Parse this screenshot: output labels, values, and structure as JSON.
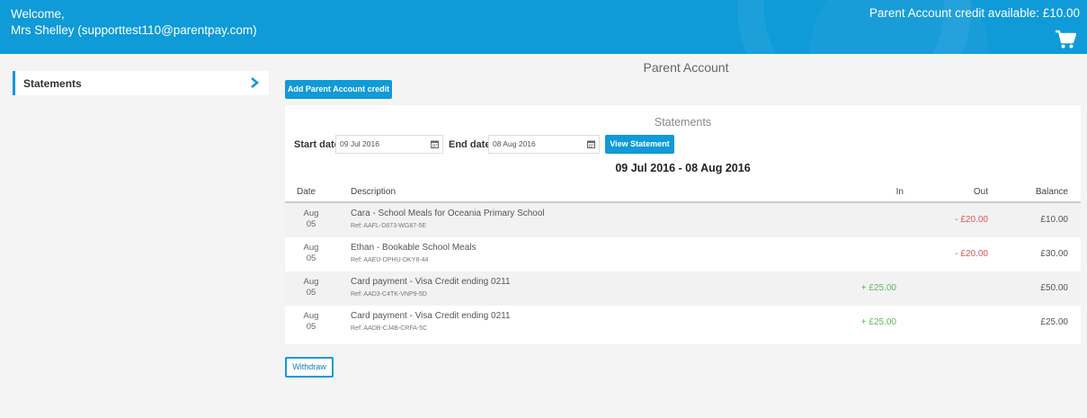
{
  "header": {
    "welcome": "Welcome,",
    "user": "Mrs Shelley (supporttest110@parentpay.com)",
    "credit_text": "Parent Account credit available: £10.00",
    "cart_icon": "shopping-cart-icon"
  },
  "sidebar": {
    "items": [
      {
        "label": "Statements",
        "icon": "chevron-right-icon"
      }
    ]
  },
  "main": {
    "title": "Parent Account",
    "add_credit_label": "Add Parent Account credit",
    "statements": {
      "title": "Statements",
      "start_label": "Start date",
      "start_value": "09 Jul 2016",
      "end_label": "End date",
      "end_value": "08 Aug 2016",
      "view_label": "View Statement",
      "range": "09 Jul 2016 - 08 Aug 2016",
      "columns": [
        "Date",
        "Description",
        "In",
        "Out",
        "Balance"
      ],
      "rows": [
        {
          "month": "Aug",
          "day": "05",
          "desc": "Cara - School Meals for Oceania Primary School",
          "ref": "Ref: AAFL-D873-WG87-5E",
          "in": "",
          "out": "- £20.00",
          "balance": "£10.00"
        },
        {
          "month": "Aug",
          "day": "05",
          "desc": "Ethan - Bookable School Meals",
          "ref": "Ref: AAEU-DPHU-DKY8-44",
          "in": "",
          "out": "- £20.00",
          "balance": "£30.00"
        },
        {
          "month": "Aug",
          "day": "05",
          "desc": "Card payment - Visa Credit ending 0211",
          "ref": "Ref: AAD3-C4TK-VNP9-5D",
          "in": "+ £25.00",
          "out": "",
          "balance": "£50.00"
        },
        {
          "month": "Aug",
          "day": "05",
          "desc": "Card payment - Visa Credit ending 0211",
          "ref": "Ref: AADB-CJ4B-CRFA-5C",
          "in": "+ £25.00",
          "out": "",
          "balance": "£25.00"
        }
      ]
    },
    "withdraw_label": "Withdraw"
  },
  "colors": {
    "brand": "#0f9ad8",
    "in": "#5cb85c",
    "out": "#e05555"
  }
}
